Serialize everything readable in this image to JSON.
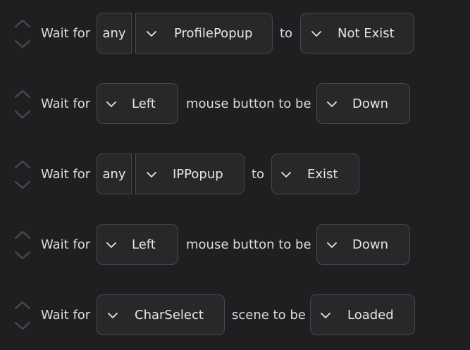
{
  "steps": [
    {
      "wait_label": "Wait for",
      "scope": "any",
      "target": "ProfilePopup",
      "connector": "to",
      "state": "Not Exist"
    },
    {
      "wait_label": "Wait for",
      "target": "Left",
      "connector": "mouse button to be",
      "state": "Down"
    },
    {
      "wait_label": "Wait for",
      "scope": "any",
      "target": "IPPopup",
      "connector": "to",
      "state": "Exist"
    },
    {
      "wait_label": "Wait for",
      "target": "Left",
      "connector": "mouse button to be",
      "state": "Down"
    },
    {
      "wait_label": "Wait for",
      "target": "CharSelect",
      "connector": "scene to be",
      "state": "Loaded"
    }
  ],
  "icons": {
    "move_up": "chevron-up-icon",
    "move_down": "chevron-down-icon",
    "dropdown": "chevron-down-icon"
  },
  "colors": {
    "background": "#1f1f21",
    "control": "#28282b",
    "border": "#48484c",
    "text": "#e4e4e6"
  }
}
